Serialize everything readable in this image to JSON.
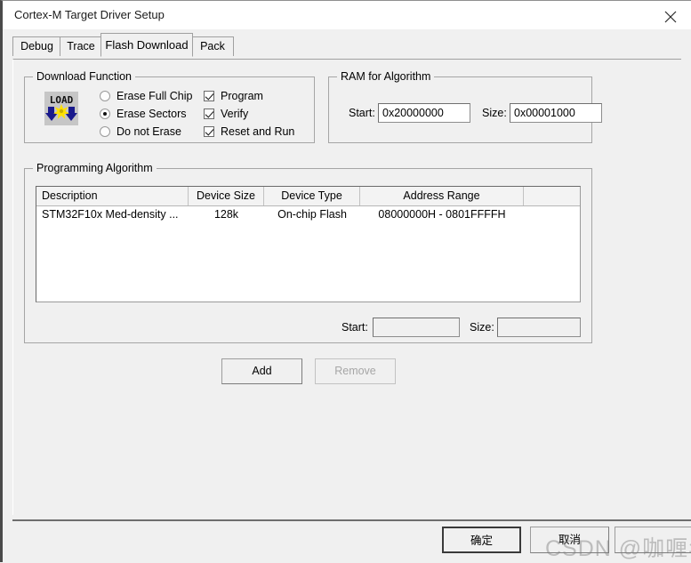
{
  "window": {
    "title": "Cortex-M Target Driver Setup",
    "close_icon": "close-icon",
    "bg_color": "#f0f0f0"
  },
  "tabs": [
    {
      "label": "Debug",
      "active": false
    },
    {
      "label": "Trace",
      "active": false
    },
    {
      "label": "Flash Download",
      "active": true
    },
    {
      "label": "Pack",
      "active": false
    }
  ],
  "download_function": {
    "title": "Download Function",
    "icon": "load-icon",
    "erase_options": [
      {
        "label": "Erase Full Chip",
        "selected": false
      },
      {
        "label": "Erase Sectors",
        "selected": true
      },
      {
        "label": "Do not Erase",
        "selected": false
      }
    ],
    "checkboxes": [
      {
        "label": "Program",
        "checked": true
      },
      {
        "label": "Verify",
        "checked": true
      },
      {
        "label": "Reset and Run",
        "checked": true
      }
    ]
  },
  "ram_for_algorithm": {
    "title": "RAM for Algorithm",
    "start_label": "Start:",
    "start_value": "0x20000000",
    "size_label": "Size:",
    "size_value": "0x00001000"
  },
  "programming_algorithm": {
    "title": "Programming Algorithm",
    "columns": [
      "Description",
      "Device Size",
      "Device Type",
      "Address Range",
      ""
    ],
    "rows": [
      {
        "description": "STM32F10x Med-density ...",
        "device_size": "128k",
        "device_type": "On-chip Flash",
        "address_range": "08000000H - 0801FFFFH",
        "extra": ""
      }
    ],
    "start_label": "Start:",
    "start_value": "",
    "size_label": "Size:",
    "size_value": "",
    "add_label": "Add",
    "remove_label": "Remove"
  },
  "footer": {
    "ok_label": "确定",
    "cancel_label": "取消",
    "help_label": "",
    "watermark": "CSDN @咖喱年糕"
  }
}
